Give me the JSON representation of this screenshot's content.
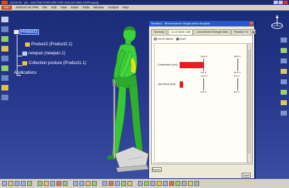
{
  "window": {
    "title": "CATIA V5 - [04 - DELTOID POSTURE FOR COLLECTING.CATProduct]",
    "colors": {
      "title_bar": "#1c2a72",
      "viewport_top": "#1b2c78",
      "viewport_bottom": "#3a4da2"
    }
  },
  "menubar": {
    "start_label": "Start",
    "items": [
      "ENOVIA V5 VPM",
      "File",
      "Edit",
      "View",
      "Insert",
      "Tools",
      "Window",
      "Analyze",
      "Help"
    ]
  },
  "tree": {
    "product1": "Product1",
    "product2": "Product2 (Product2.1)",
    "newpan": "newpan (newpan.1)",
    "collection": "Collection posture (Product1.1)",
    "applications": "Applications"
  },
  "dialog": {
    "title": "Manikin1 - Biomechanics Single Action Analysis",
    "close_glyph": "×",
    "tabs": [
      "Summary",
      "L4-L5 Spine Limit",
      "Joint Moment Strength Data",
      "Reaction For"
    ],
    "active_tab": 1,
    "tab_scroll_glyph": "◂▸",
    "view_options": {
      "list": "List of Values",
      "chart": "Chart",
      "selected": "chart"
    },
    "export_label": "Export...",
    "close_label": "Close",
    "bar_color": "#e81d1d"
  },
  "chart_data": {
    "type": "bar",
    "categories": [
      "Compression (unit)",
      "Joint Shear (unit)"
    ],
    "series": [
      {
        "values": [
          3400,
          540
        ],
        "upper_labels": [
          "3400 N",
          "3400 N"
        ],
        "lower_labels": [
          "640 N",
          "540 N"
        ],
        "upper_right_labels": [
          "6400 N",
          "500 N"
        ],
        "lower_right_labels": [
          "6376 N",
          "500 N"
        ]
      }
    ]
  },
  "icons": {
    "left_toolbar": [
      "product-icon",
      "assembly-icon",
      "move-icon",
      "snap-icon",
      "constraint-icon",
      "manikin-icon",
      "posture-icon",
      "analysis-icon",
      "vision-icon"
    ],
    "right_toolbar": [
      "compass-icon",
      "fit-all-icon",
      "pan-icon",
      "rotate-icon",
      "zoom-icon",
      "normal-view-icon",
      "render-icon"
    ]
  }
}
